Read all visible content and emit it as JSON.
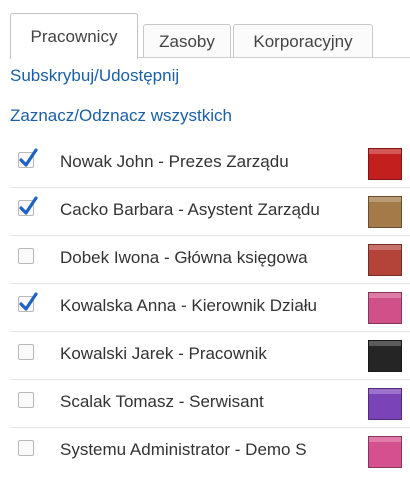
{
  "tabs": [
    {
      "label": "Pracownicy",
      "active": true
    },
    {
      "label": "Zasoby",
      "active": false
    },
    {
      "label": "Korporacyjny",
      "active": false
    }
  ],
  "actions": {
    "subscribe_label": "Subskrybuj/Udostępnij",
    "select_all_label": "Zaznacz/Odznacz wszystkich"
  },
  "employees": [
    {
      "label": "Nowak John - Prezes Zarządu",
      "checked": true,
      "color": "#c41f1f"
    },
    {
      "label": "Cacko Barbara - Asystent Zarządu",
      "checked": true,
      "color": "#a47a48"
    },
    {
      "label": "Dobek Iwona - Główna księgowa",
      "checked": false,
      "color": "#b4443a"
    },
    {
      "label": "Kowalska Anna - Kierownik Działu",
      "checked": true,
      "color": "#d0508a"
    },
    {
      "label": "Kowalski Jarek - Pracownik",
      "checked": false,
      "color": "#252525"
    },
    {
      "label": "Scalak Tomasz - Serwisant",
      "checked": false,
      "color": "#7a44b8"
    },
    {
      "label": "Systemu Administrator - Demo S",
      "checked": false,
      "color": "#d4508e"
    }
  ],
  "icons": {
    "checkmark": "checkmark-icon"
  }
}
